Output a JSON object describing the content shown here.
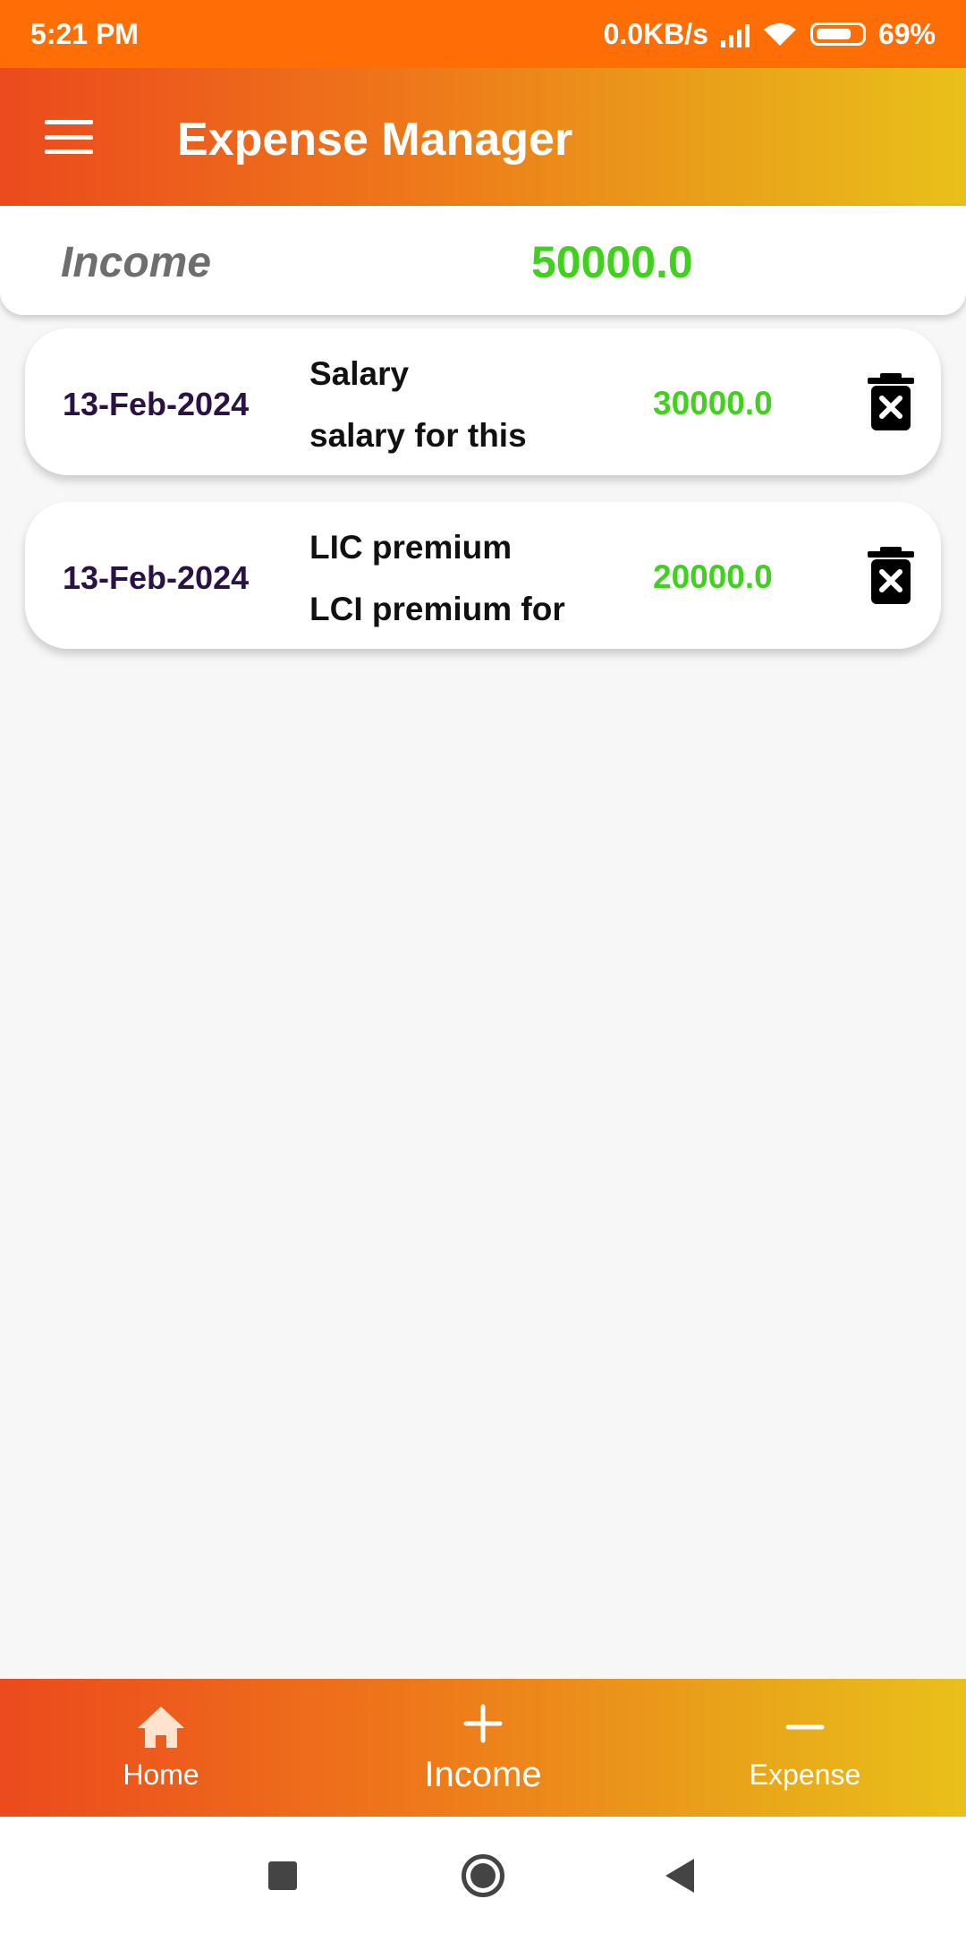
{
  "status_bar": {
    "time": "5:21 PM",
    "network_speed": "0.0KB/s",
    "battery": "69%"
  },
  "app_bar": {
    "title": "Expense Manager"
  },
  "summary": {
    "label": "Income",
    "value": "50000.0"
  },
  "entries": [
    {
      "date": "13-Feb-2024",
      "title": "Salary",
      "description": "salary for this",
      "amount": "30000.0"
    },
    {
      "date": "13-Feb-2024",
      "title": "LIC premium",
      "description": "LCI premium for",
      "amount": "20000.0"
    }
  ],
  "bottom_nav": {
    "items": [
      {
        "label": "Home",
        "icon": "home-icon"
      },
      {
        "label": "Income",
        "icon": "plus-icon"
      },
      {
        "label": "Expense",
        "icon": "minus-icon"
      }
    ],
    "active": "Income"
  },
  "colors": {
    "status_bar": "#ff6d05",
    "gradient_start": "#ec4a1d",
    "gradient_end": "#e9c01a",
    "amount_green": "#3fd11c",
    "date_purple": "#2a1244"
  }
}
